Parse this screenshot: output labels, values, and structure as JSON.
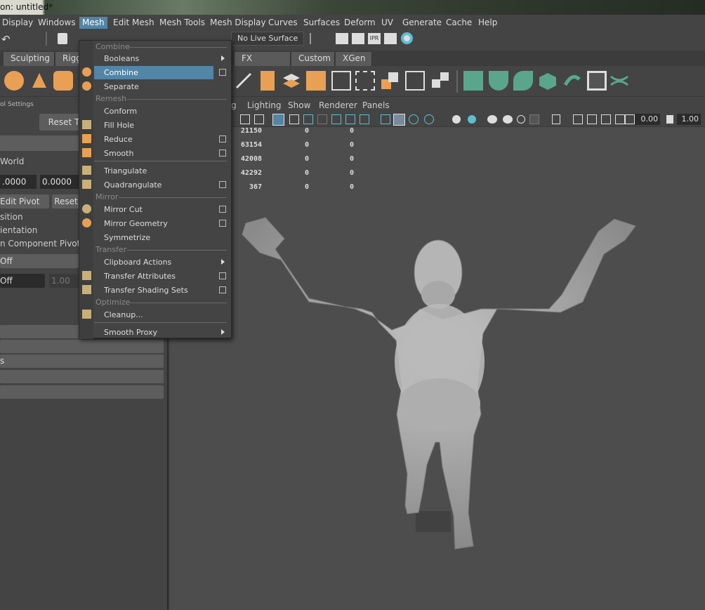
{
  "title": "on: untitled*",
  "menubar": {
    "items": [
      "Display",
      "Windows",
      "Mesh",
      "Edit Mesh",
      "Mesh Tools",
      "Mesh Display",
      "Curves",
      "Surfaces",
      "Deform",
      "UV",
      "Generate",
      "Cache",
      "Help"
    ]
  },
  "status": {
    "live_surface": "No Live Surface"
  },
  "shelf_tabs": [
    "Sculpting",
    "Rigg",
    "FX Caching",
    "Custom",
    "XGen"
  ],
  "left_panel": {
    "header": "ol Settings",
    "reset_tool": "Reset T",
    "world": "World",
    "field1": ".0000",
    "field2": "0.0000",
    "edit_pivot": "Edit Pivot",
    "reset": "Reset",
    "position": "sition",
    "orientation": "ientation",
    "component_pivot": "n Component Pivot",
    "off1": "Off",
    "off2": "Off",
    "val": "1.00",
    "s_label": "s"
  },
  "viewport": {
    "menu": [
      "g",
      "Lighting",
      "Show",
      "Renderer",
      "Panels"
    ],
    "field_a": "0.00",
    "field_b": "1.00",
    "hud": [
      [
        "21150",
        "0",
        "0"
      ],
      [
        "63154",
        "0",
        "0"
      ],
      [
        "42008",
        "0",
        "0"
      ],
      [
        "42292",
        "0",
        "0"
      ],
      [
        "367",
        "0",
        "0"
      ]
    ]
  },
  "dropdown": {
    "sec_combine": "Combine",
    "booleans": "Booleans",
    "combine": "Combine",
    "separate": "Separate",
    "sec_remesh": "Remesh",
    "conform": "Conform",
    "fill_hole": "Fill Hole",
    "reduce": "Reduce",
    "smooth": "Smooth",
    "triangulate": "Triangulate",
    "quadrangulate": "Quadrangulate",
    "sec_mirror": "Mirror",
    "mirror_cut": "Mirror Cut",
    "mirror_geometry": "Mirror Geometry",
    "symmetrize": "Symmetrize",
    "sec_transfer": "Transfer",
    "clipboard_actions": "Clipboard Actions",
    "transfer_attributes": "Transfer Attributes",
    "transfer_shading_sets": "Transfer Shading Sets",
    "sec_optimize": "Optimize",
    "cleanup": "Cleanup...",
    "smooth_proxy": "Smooth Proxy"
  },
  "colors": {
    "accent": "#5285a6",
    "orange": "#e8a055",
    "teal": "#5aa68c",
    "panel": "#444444",
    "viewport": "#4d4d4d"
  }
}
